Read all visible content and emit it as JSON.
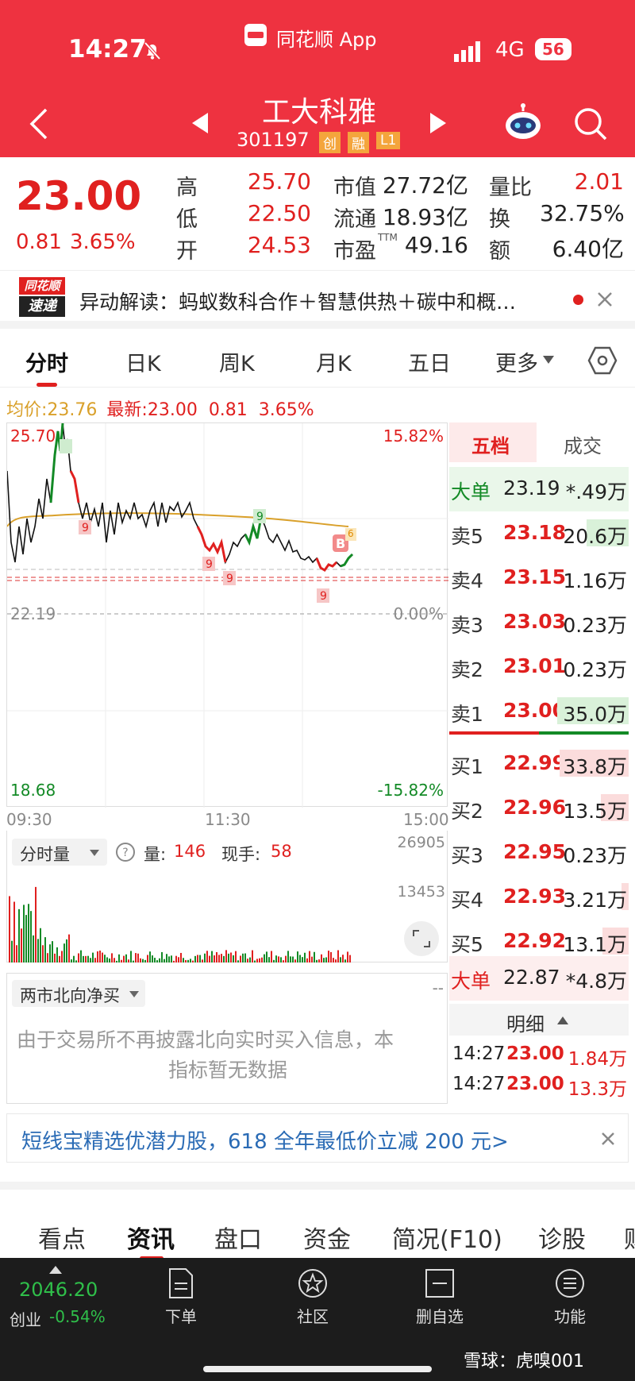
{
  "status_bar": {
    "time": "14:27",
    "app_name": "同花顺 App",
    "network": "4G",
    "battery": "56"
  },
  "header": {
    "stock_name": "工大科雅",
    "stock_code": "301197",
    "badges": [
      "创",
      "融",
      "L1"
    ]
  },
  "quote": {
    "price": "23.00",
    "change": "0.81",
    "change_pct": "3.65%",
    "fields": [
      {
        "label": "高",
        "value": "25.70",
        "color": "#e0201f"
      },
      {
        "label": "低",
        "value": "22.50",
        "color": "#e0201f"
      },
      {
        "label": "开",
        "value": "24.53",
        "color": "#e0201f"
      },
      {
        "label": "市值",
        "value": "27.72亿",
        "color": "#222222"
      },
      {
        "label": "流通",
        "value": "18.93亿",
        "color": "#222222"
      },
      {
        "label": "市盈",
        "sup": "TTM",
        "value": "49.16",
        "color": "#222222"
      },
      {
        "label": "量比",
        "value": "2.01",
        "color": "#e0201f"
      },
      {
        "label": "换",
        "value": "32.75%",
        "color": "#222222"
      },
      {
        "label": "额",
        "value": "6.40亿",
        "color": "#222222"
      }
    ]
  },
  "news": {
    "logo_top": "同花顺",
    "logo_bottom": "速递",
    "text": "异动解读：蚂蚁数科合作＋智慧供热＋碳中和概…"
  },
  "tabs": [
    "分时",
    "日K",
    "周K",
    "月K",
    "五日",
    "更多"
  ],
  "info_line": {
    "avg_label": "均价:",
    "avg_value": "23.76",
    "latest_label": "最新:",
    "latest_value": "23.00",
    "change": "0.81",
    "change_pct": "3.65%"
  },
  "chart": {
    "y_top": "25.70",
    "y_top_pct": "15.82%",
    "y_mid": "22.19",
    "y_mid_pct": "0.00%",
    "y_bottom": "18.68",
    "y_bottom_pct": "-15.82%",
    "x_labels": [
      "09:30",
      "11:30",
      "15:00"
    ],
    "markers": [
      "9",
      "9",
      "9",
      "9",
      "9",
      "B",
      "6"
    ]
  },
  "volume": {
    "selector": "分时量",
    "vol_label": "量:",
    "vol_value": "146",
    "hand_label": "现手:",
    "hand_value": "58",
    "y_top": "26905",
    "y_mid": "13453"
  },
  "north": {
    "selector": "两市北向净买",
    "dashes": "--",
    "message_1": "由于交易所不再披露北向实时买入信息，本",
    "message_2": "指标暂无数据"
  },
  "book": {
    "tabs": [
      "五档",
      "成交"
    ],
    "top_big": {
      "label": "大单",
      "price": "23.19",
      "vol": "*.49万"
    },
    "asks": [
      {
        "label": "卖5",
        "price": "23.18",
        "vol": "20.6万",
        "bar": 0.35
      },
      {
        "label": "卖4",
        "price": "23.15",
        "vol": "1.16万",
        "bar": 0.0
      },
      {
        "label": "卖3",
        "price": "23.03",
        "vol": "0.23万",
        "bar": 0.0
      },
      {
        "label": "卖2",
        "price": "23.01",
        "vol": "0.23万",
        "bar": 0.0
      },
      {
        "label": "卖1",
        "price": "23.00",
        "vol": "35.0万",
        "bar": 0.6
      }
    ],
    "bids": [
      {
        "label": "买1",
        "price": "22.99",
        "vol": "33.8万",
        "bar": 0.58
      },
      {
        "label": "买2",
        "price": "22.96",
        "vol": "13.5万",
        "bar": 0.23
      },
      {
        "label": "买3",
        "price": "22.95",
        "vol": "0.23万",
        "bar": 0.0
      },
      {
        "label": "买4",
        "price": "22.93",
        "vol": "3.21万",
        "bar": 0.06
      },
      {
        "label": "买5",
        "price": "22.92",
        "vol": "13.1万",
        "bar": 0.22
      }
    ],
    "bottom_big": {
      "label": "大单",
      "price": "22.87",
      "vol": "*4.8万"
    },
    "detail_label": "明细",
    "trades": [
      {
        "time": "14:27",
        "price": "23.00",
        "vol": "1.84万"
      },
      {
        "time": "14:27",
        "price": "23.00",
        "vol": "13.3万"
      }
    ]
  },
  "banner": {
    "text": "短线宝精选优潜力股，618 全年最低价立减 200 元>"
  },
  "bottom_tabs": [
    "看点",
    "资讯",
    "盘口",
    "资金",
    "简况(F10)",
    "诊股",
    "财"
  ],
  "bottom_bar": {
    "index_value": "2046.20",
    "index_name": "创业",
    "index_change": "-0.54%",
    "items": [
      "下单",
      "社区",
      "删自选",
      "功能"
    ]
  },
  "watermark": "雪球：虎嗅001",
  "colors": {
    "header": "#ee3240",
    "up": "#e0201f",
    "down": "#138a26",
    "avg_line": "#d9a02a"
  }
}
